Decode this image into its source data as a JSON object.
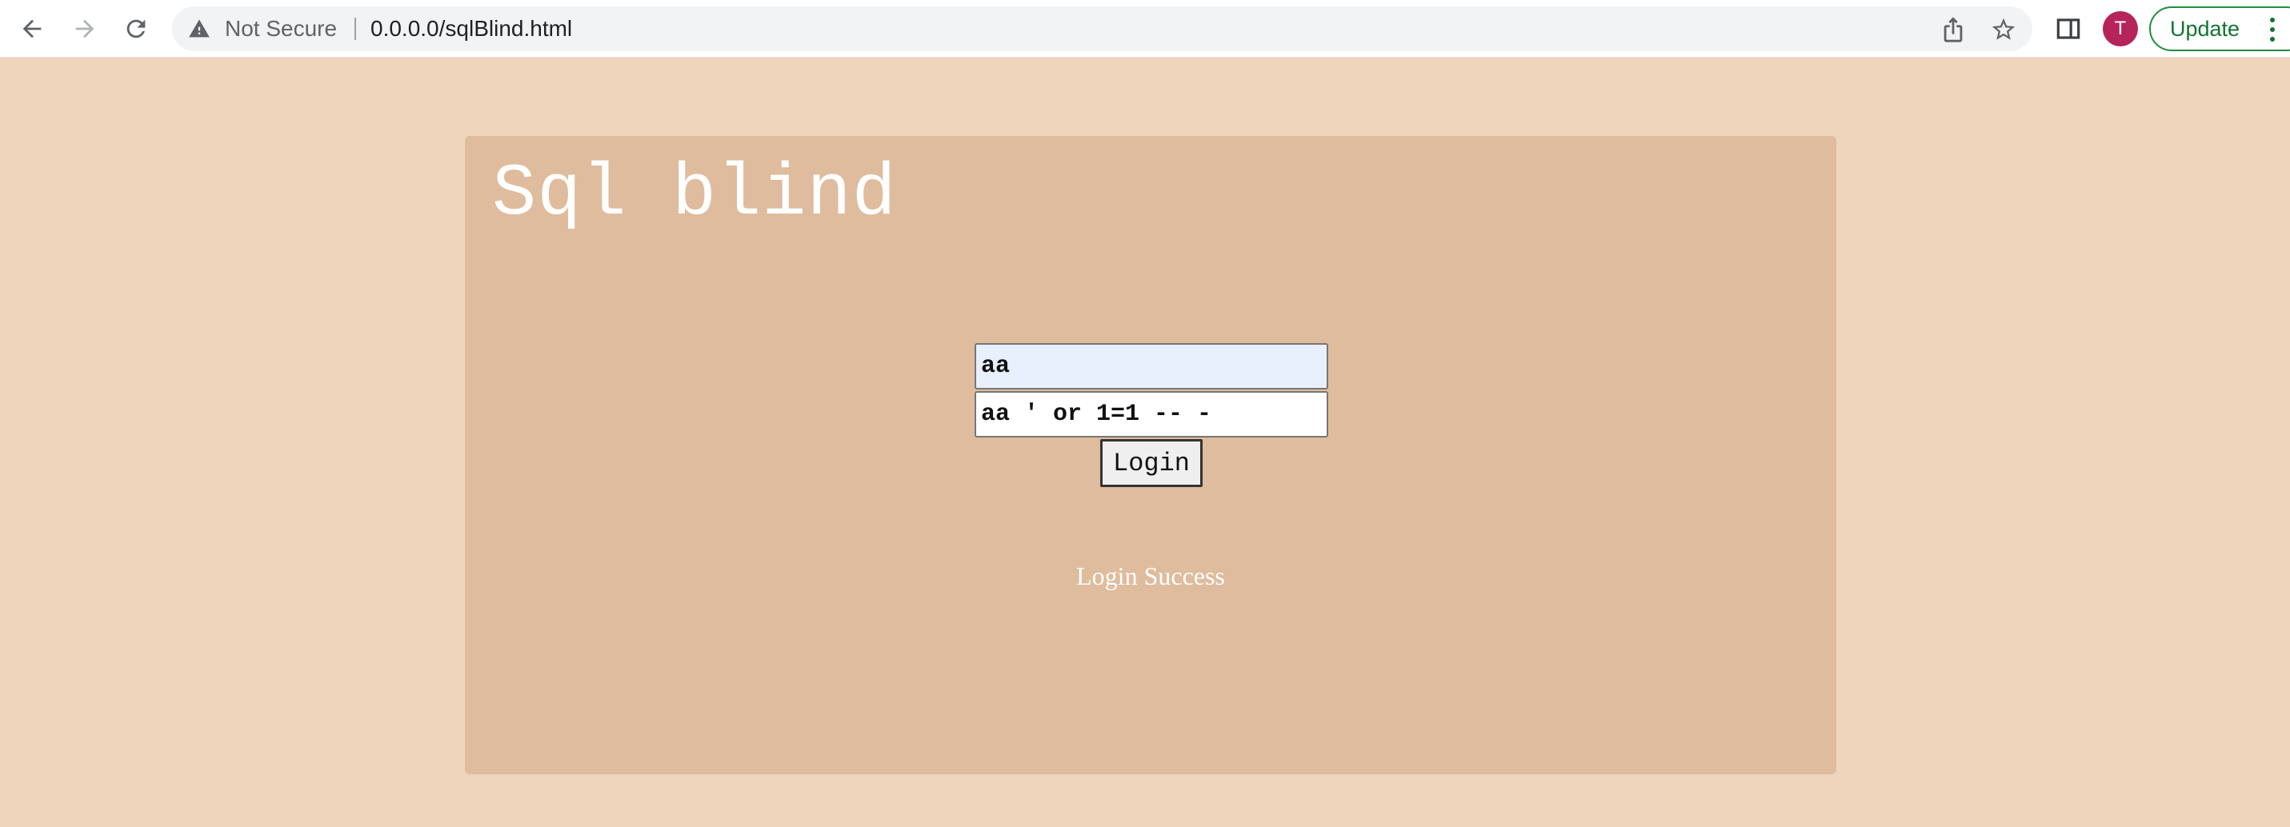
{
  "browser": {
    "security_label": "Not Secure",
    "url": "0.0.0.0/sqlBlind.html",
    "avatar_initial": "T",
    "update_label": "Update"
  },
  "page": {
    "title": "Sql blind",
    "form": {
      "username_value": "aa",
      "password_value": "aa ' or 1=1 -- -",
      "login_label": "Login"
    },
    "status_message": "Login Success"
  },
  "colors": {
    "page_background": "#eed5bb",
    "panel_background": "#dfbc9d",
    "autofill_background": "#e8f0fe",
    "avatar": "#b5245a",
    "update_accent": "#1e8e3e"
  }
}
